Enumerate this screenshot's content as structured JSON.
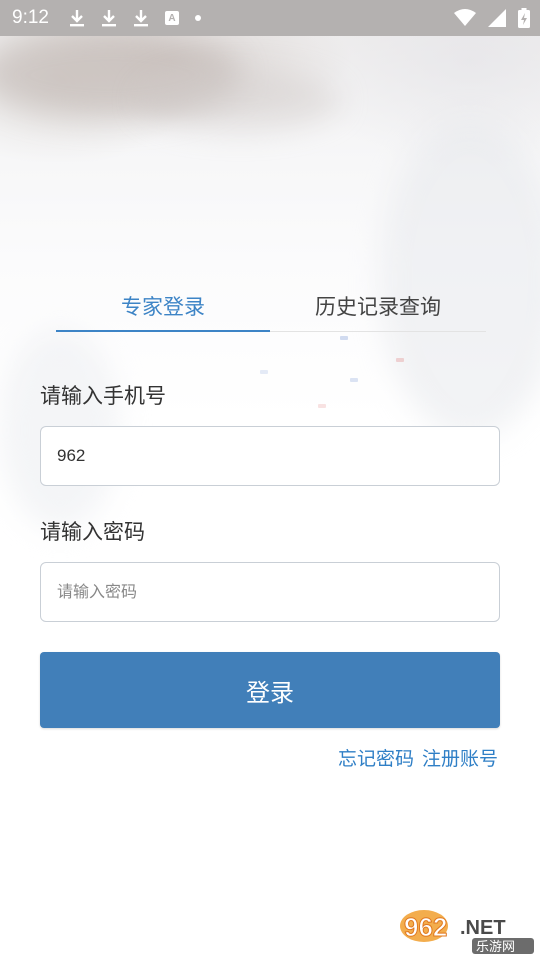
{
  "status_bar": {
    "time": "9:12",
    "left_icons": [
      "download-icon",
      "download-icon",
      "download-icon",
      "a-icon",
      "dot-icon"
    ],
    "a_icon_text": "A",
    "right_icons": [
      "wifi-icon",
      "signal-icon",
      "battery-icon"
    ]
  },
  "tabs": [
    {
      "label": "专家登录",
      "active": true
    },
    {
      "label": "历史记录查询",
      "active": false
    }
  ],
  "form": {
    "phone_label": "请输入手机号",
    "phone_value": "962",
    "password_label": "请输入密码",
    "password_placeholder": "请输入密码"
  },
  "login_button": "登录",
  "links": {
    "forgot": "忘记密码",
    "register": "注册账号"
  },
  "watermark": {
    "brand_num": "962",
    "brand_dot": ".NET",
    "brand_sub": "乐游网"
  },
  "colors": {
    "accent": "#3d84c6",
    "button": "#417fb9",
    "status_bar": "#b4b1b0",
    "link": "#2f7fc6"
  }
}
